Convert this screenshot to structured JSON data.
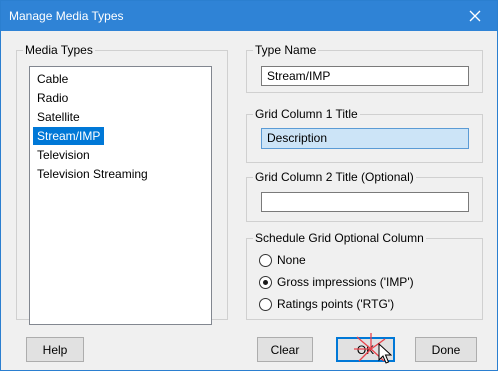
{
  "window": {
    "title": "Manage Media Types"
  },
  "media_types": {
    "legend": "Media Types",
    "items": [
      "Cable",
      "Radio",
      "Satellite",
      "Stream/IMP",
      "Television",
      "Television Streaming"
    ],
    "selected": "Stream/IMP"
  },
  "type_name": {
    "legend": "Type Name",
    "value": "Stream/IMP"
  },
  "grid_col1": {
    "legend": "Grid Column 1 Title",
    "value": "Description"
  },
  "grid_col2": {
    "legend": "Grid Column 2 Title (Optional)",
    "value": ""
  },
  "schedule_grid": {
    "legend": "Schedule Grid Optional Column",
    "options": [
      {
        "label": "None",
        "checked": false
      },
      {
        "label": "Gross impressions ('IMP')",
        "checked": true
      },
      {
        "label": "Ratings points ('RTG')",
        "checked": false
      }
    ]
  },
  "buttons": {
    "help": "Help",
    "clear": "Clear",
    "ok": "OK",
    "done": "Done"
  },
  "icons": {
    "close": "close-icon",
    "cursor": "mouse-pointer-icon",
    "click": "click-burst-icon"
  }
}
